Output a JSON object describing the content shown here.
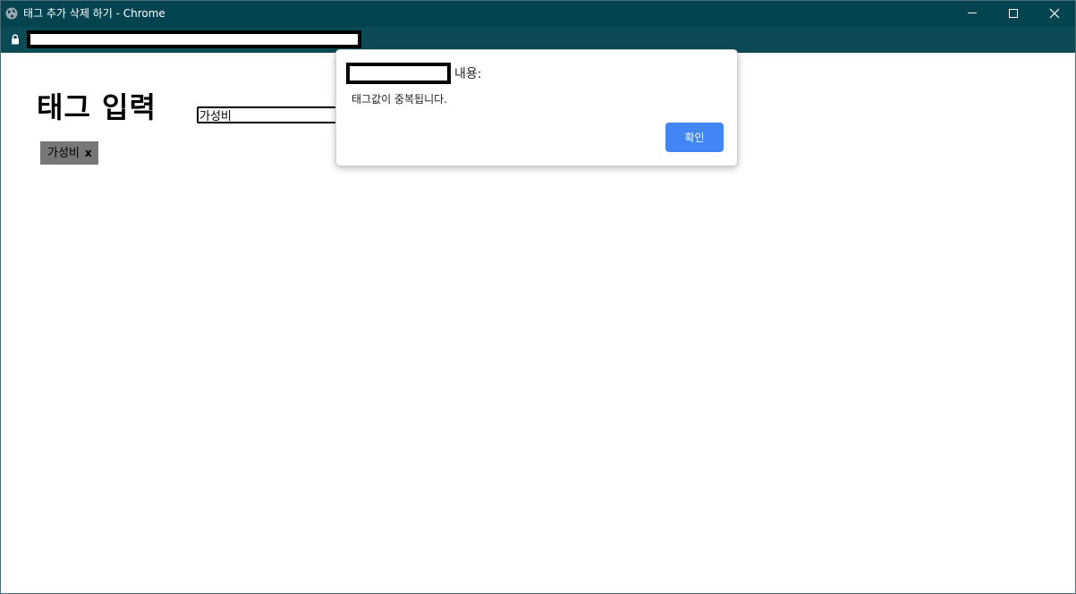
{
  "window": {
    "title": "태그 추가 삭제 하기 - Chrome"
  },
  "addressbar": {
    "url": ""
  },
  "page": {
    "heading": "태그 입력",
    "input_value": "가성비",
    "tags": [
      {
        "label": "가성비",
        "remove_label": "x"
      }
    ]
  },
  "dialog": {
    "title_suffix": "내용:",
    "message": "태그값이 중복됩니다.",
    "ok_label": "확인"
  },
  "colors": {
    "titlebar_bg": "#034450",
    "addressbar_bg": "#0c4b56",
    "tag_bg": "#777777",
    "ok_button_bg": "#4285f4"
  },
  "icons": [
    "globe-icon",
    "minimize-icon",
    "maximize-icon",
    "close-icon",
    "lock-icon"
  ]
}
